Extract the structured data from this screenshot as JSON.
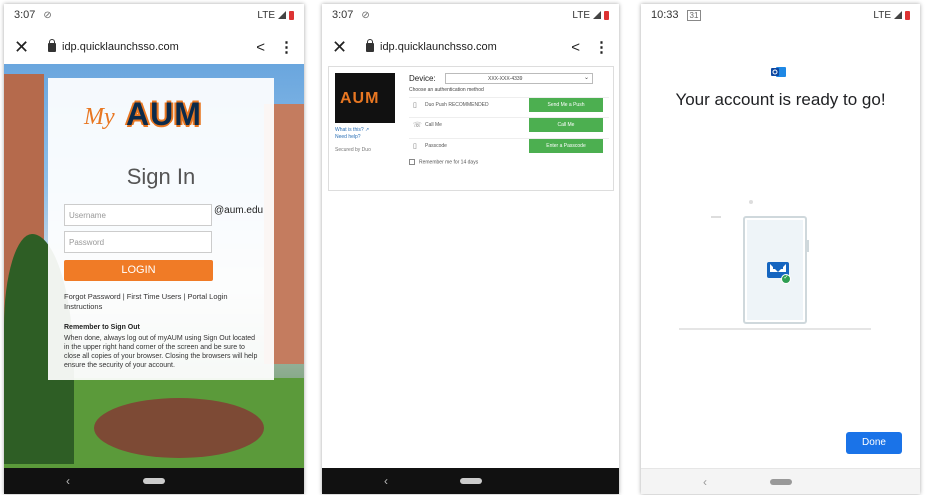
{
  "phone1": {
    "status": {
      "time": "3:07",
      "network": "LTE"
    },
    "url": "idp.quicklaunchsso.com",
    "brand": {
      "my": "My",
      "aum": "AUM"
    },
    "title": "Sign In",
    "username_placeholder": "Username",
    "domain_suffix": "@aum.edu",
    "password_placeholder": "Password",
    "login_label": "LOGIN",
    "links": "Forgot Password | First Time Users | Portal Login Instructions",
    "remember_title": "Remember to Sign Out",
    "remember_text": "When done, always log out of myAUM using Sign Out located in the upper right hand corner of the screen and be sure to close all copies of your browser. Closing the browsers will help ensure the security of your account."
  },
  "phone2": {
    "status": {
      "time": "3:07",
      "network": "LTE"
    },
    "url": "idp.quicklaunchsso.com",
    "logo_text": "AUM",
    "what_is_this": "What is this? ↗",
    "need_help": "Need help?",
    "secured_by": "Secured by Duo",
    "device_label": "Device:",
    "device_value": "XXX-XXX-4339",
    "choose_method": "Choose an authentication method",
    "methods": [
      {
        "name": "Duo Push RECOMMENDED",
        "button": "Send Me a Push"
      },
      {
        "name": "Call Me",
        "button": "Call Me"
      },
      {
        "name": "Passcode",
        "button": "Enter a Passcode"
      }
    ],
    "remember_me": "Remember me for 14 days"
  },
  "phone3": {
    "status": {
      "time": "10:33",
      "calendar": "31",
      "network": "LTE"
    },
    "headline": "Your account is ready to go!",
    "done_label": "Done"
  }
}
